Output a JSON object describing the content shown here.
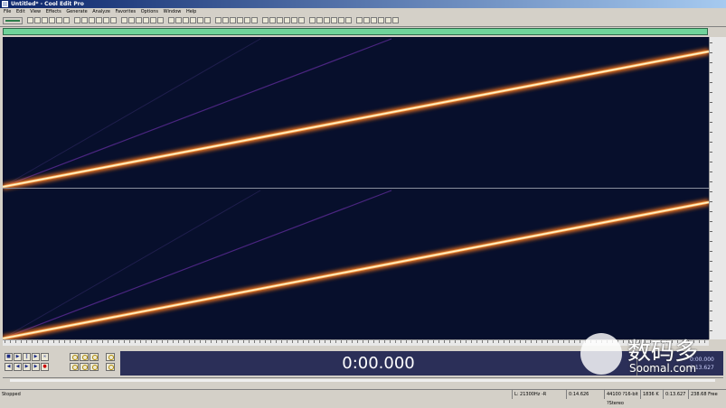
{
  "window": {
    "title": "Untitled* - Cool Edit Pro"
  },
  "menu": [
    "File",
    "Edit",
    "View",
    "Effects",
    "Generate",
    "Analyze",
    "Favorites",
    "Options",
    "Window",
    "Help"
  ],
  "display": {
    "time": "0:00.000",
    "sel_begin": "0:00.000",
    "sel_end": "0:13.627"
  },
  "status": {
    "state": "Stopped",
    "cursor": "L: 21300Hz  -R",
    "position": "0:14.626",
    "format": "44100 ?16-bit ?Stereo",
    "size": "1836 K",
    "length": "0:13.627",
    "free": "238.68 Free"
  },
  "watermark": {
    "cn": "数码多",
    "url": "Soomal.com"
  },
  "colors": {
    "spectrogram_bg": "#070f2c",
    "sweep_core": "#fff3c0",
    "sweep_glow": "#ff8a2a",
    "harmonic": "#6a2a9a",
    "overview": "#6fd39a",
    "time_panel": "#2b2f58"
  }
}
